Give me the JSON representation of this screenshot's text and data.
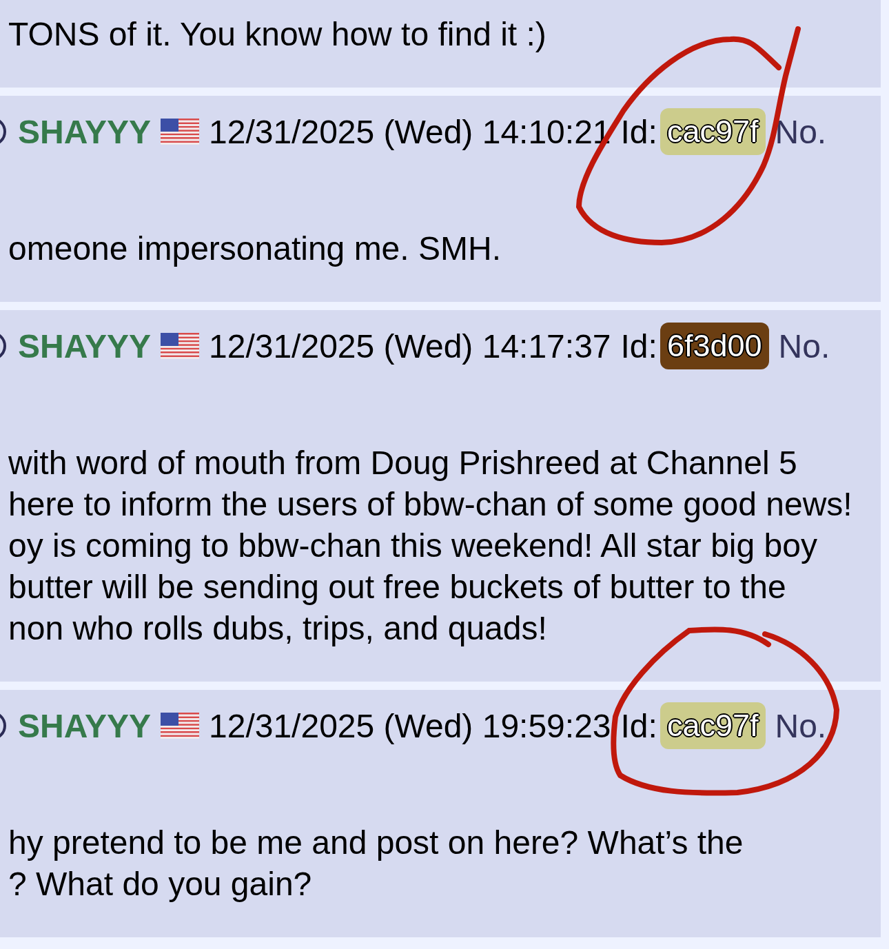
{
  "posts": [
    {
      "kind": "partial",
      "body": [
        "TONS of it. You know how to find it :)"
      ]
    },
    {
      "kind": "post",
      "name": "SHAYYY",
      "date": "12/31/2025 (Wed) 14:10:21",
      "id_label": "Id:",
      "id": "cac97f",
      "color": "#cccc8c",
      "no": "No.",
      "body": [
        "omeone impersonating me. SMH."
      ]
    },
    {
      "kind": "post",
      "name": "SHAYYY",
      "date": "12/31/2025 (Wed) 14:17:37",
      "id_label": "Id:",
      "id": "6f3d00",
      "color": "#6b3e12",
      "no": "No.",
      "body": [
        "with word of mouth from Doug Prishreed at Channel 5",
        "here to inform the users of bbw-chan of some good news!",
        "oy is coming to bbw-chan this weekend! All star big boy",
        "butter will be sending out free buckets of butter to the",
        "non who rolls dubs, trips, and quads!"
      ]
    },
    {
      "kind": "post",
      "name": "SHAYYY",
      "date": "12/31/2025 (Wed) 19:59:23",
      "id_label": "Id:",
      "id": "cac97f",
      "color": "#cccc8c",
      "no": "No.",
      "body": [
        "hy pretend to be me and post on here? What’s the",
        "? What do you gain?"
      ]
    }
  ]
}
